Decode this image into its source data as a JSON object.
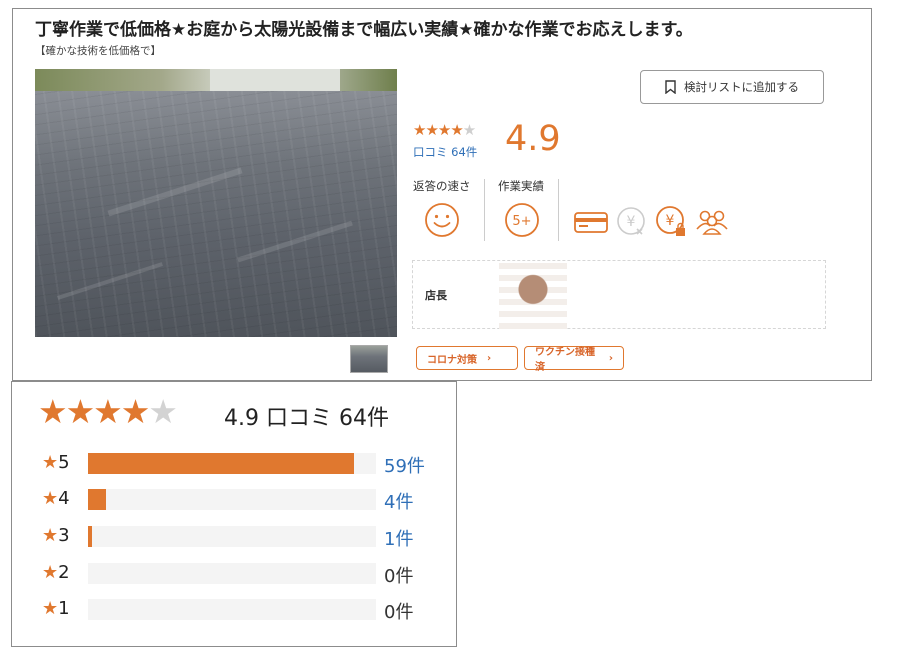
{
  "listing": {
    "title": "丁寧作業で低価格★お庭から太陽光設備まで幅広い実績★確かな作業でお応えします。",
    "subtitle": "【確かな技術を低価格で】",
    "add_to_list_label": "検討リストに追加する",
    "rating_value": "4.9",
    "reviews_link": "口コミ 64件",
    "metrics": {
      "response_speed_label": "返答の速さ",
      "work_record_label": "作業実績",
      "work_record_value": "5+"
    },
    "staff_role": "店長",
    "tags": [
      {
        "label": "コロナ対策"
      },
      {
        "label": "ワクチン接種済"
      }
    ]
  },
  "rating_summary": {
    "value": "4.9",
    "reviews_text": "口コミ 64件",
    "stars_filled": 4,
    "stars_total": 5,
    "breakdown": [
      {
        "star_label": "5",
        "count_text": "59件",
        "fraction": 0.922
      },
      {
        "star_label": "4",
        "count_text": "4件",
        "fraction": 0.0625
      },
      {
        "star_label": "3",
        "count_text": "1件",
        "fraction": 0.0156
      },
      {
        "star_label": "2",
        "count_text": "0件",
        "fraction": 0
      },
      {
        "star_label": "1",
        "count_text": "0件",
        "fraction": 0
      }
    ]
  },
  "colors": {
    "accent": "#e0782f",
    "link": "#2f6fb7"
  }
}
